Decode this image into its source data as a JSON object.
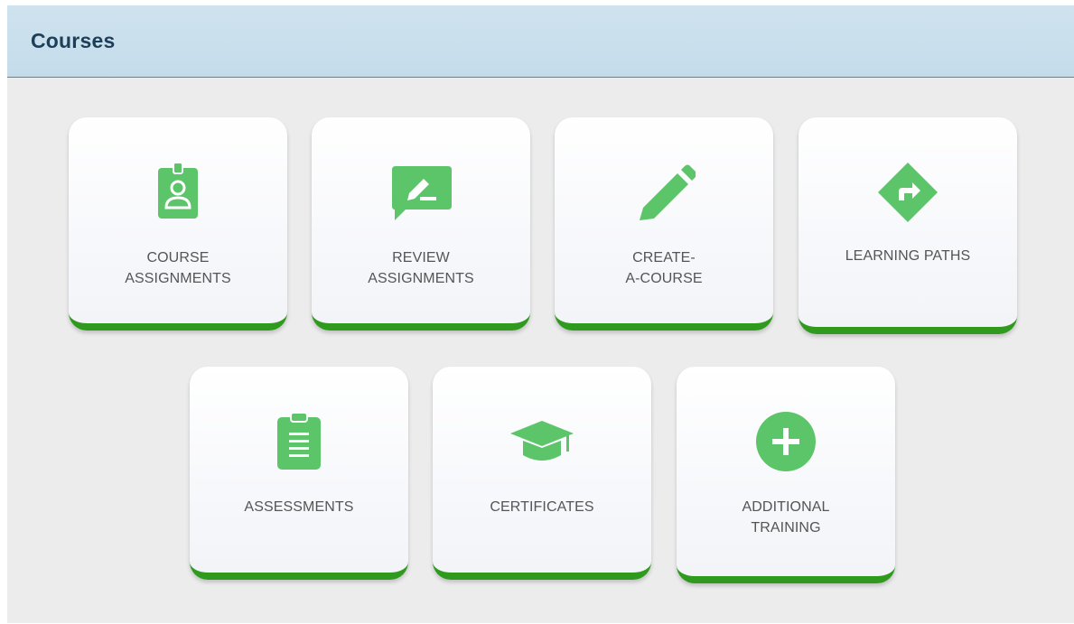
{
  "panel": {
    "title": "Courses"
  },
  "tiles": [
    {
      "id": "course-assignments",
      "icon": "id-badge-icon",
      "label_lines": [
        "COURSE",
        "ASSIGNMENTS"
      ]
    },
    {
      "id": "review-assignments",
      "icon": "comment-edit-icon",
      "label_lines": [
        "REVIEW",
        "ASSIGNMENTS"
      ]
    },
    {
      "id": "create-a-course",
      "icon": "pencil-icon",
      "label_lines": [
        "CREATE-",
        "A-COURSE"
      ]
    },
    {
      "id": "learning-paths",
      "icon": "directions-sign-icon",
      "label_lines": [
        "LEARNING PATHS"
      ]
    },
    {
      "id": "assessments",
      "icon": "clipboard-icon",
      "label_lines": [
        "ASSESSMENTS"
      ]
    },
    {
      "id": "certificates",
      "icon": "graduation-cap-icon",
      "label_lines": [
        "CERTIFICATES"
      ]
    },
    {
      "id": "additional-training",
      "icon": "plus-circle-icon",
      "label_lines": [
        "ADDITIONAL",
        "TRAINING"
      ]
    }
  ],
  "colors": {
    "icon_green": "#5cc569",
    "accent_green": "#2f9a1e",
    "header_bg": "#c4dcea",
    "title_text": "#1e3f5a",
    "label_text": "#555555"
  }
}
